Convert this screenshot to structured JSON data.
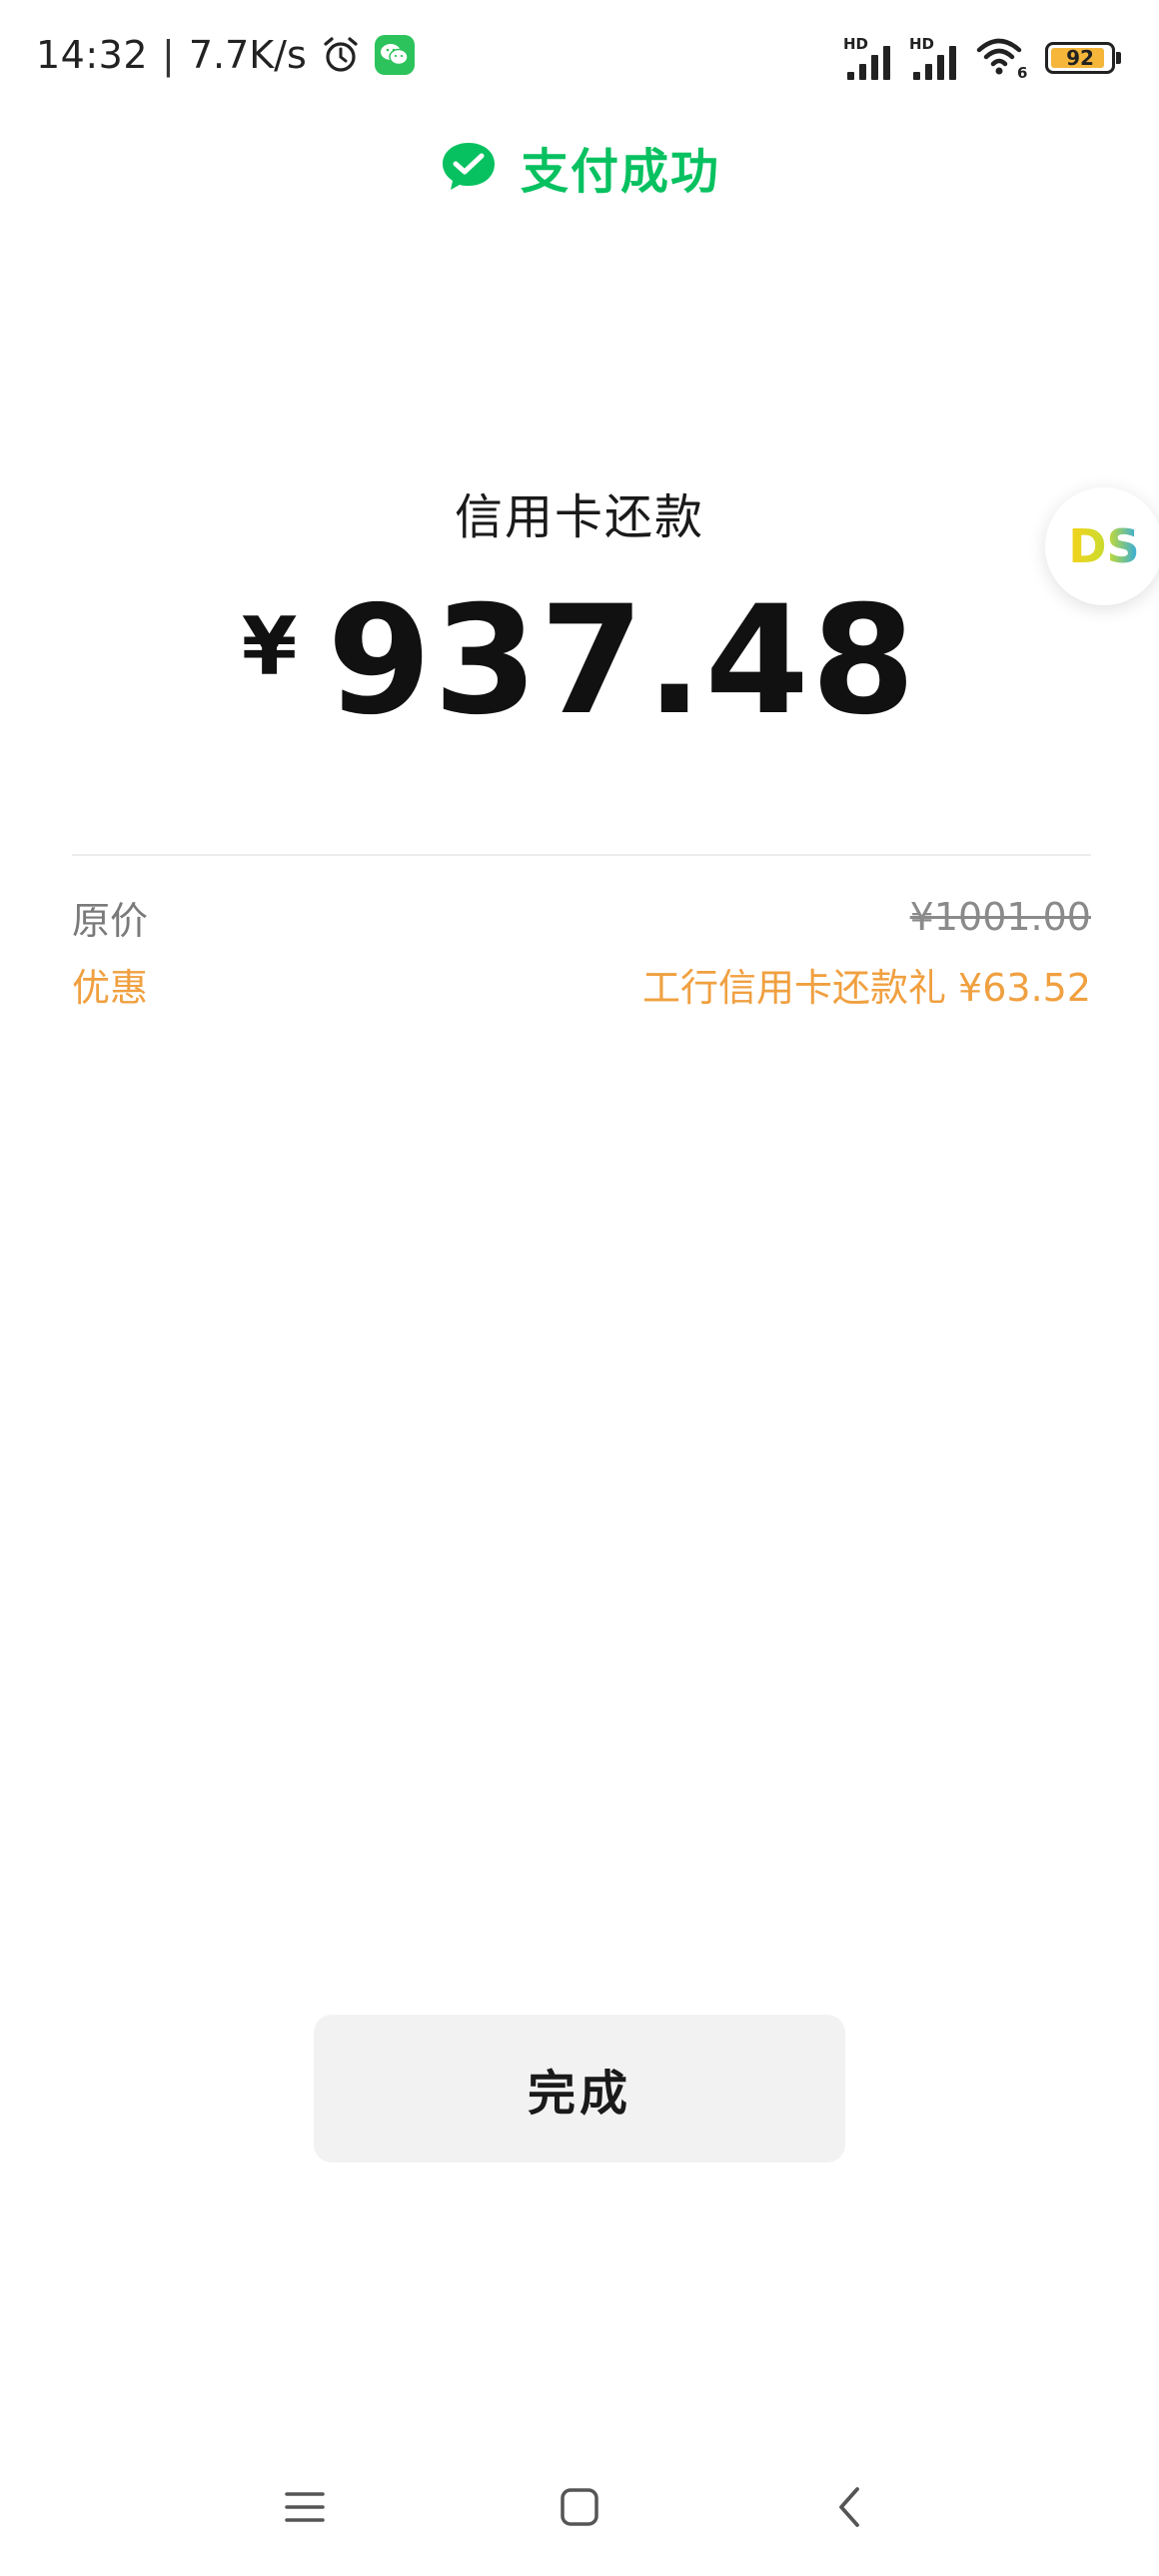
{
  "status_bar": {
    "time": "14:32",
    "separator": "|",
    "net_speed": "7.7K/s",
    "signal_1_label": "HD",
    "signal_2_label": "HD",
    "wifi_badge": "6",
    "battery_level": "92",
    "battery_fraction": 0.92,
    "icons": [
      "alarm-icon",
      "wechat-notification-icon",
      "signal-icon",
      "signal-icon",
      "wifi-icon",
      "battery-icon"
    ]
  },
  "header": {
    "title": "支付成功",
    "icon": "check-circle-icon",
    "accent_color": "#07c160"
  },
  "payment": {
    "merchant": "信用卡还款",
    "currency_symbol": "¥",
    "amount": "937.48"
  },
  "details": {
    "original_label": "原价",
    "original_value": "¥1001.00",
    "discount_label": "优惠",
    "discount_value": "工行信用卡还款礼 ¥63.52",
    "discount_color": "#f0a040"
  },
  "actions": {
    "done_label": "完成"
  },
  "floating_bubble": {
    "text": "DS"
  },
  "nav_bar": {
    "icons": [
      "menu-icon",
      "home-icon",
      "back-icon"
    ]
  }
}
